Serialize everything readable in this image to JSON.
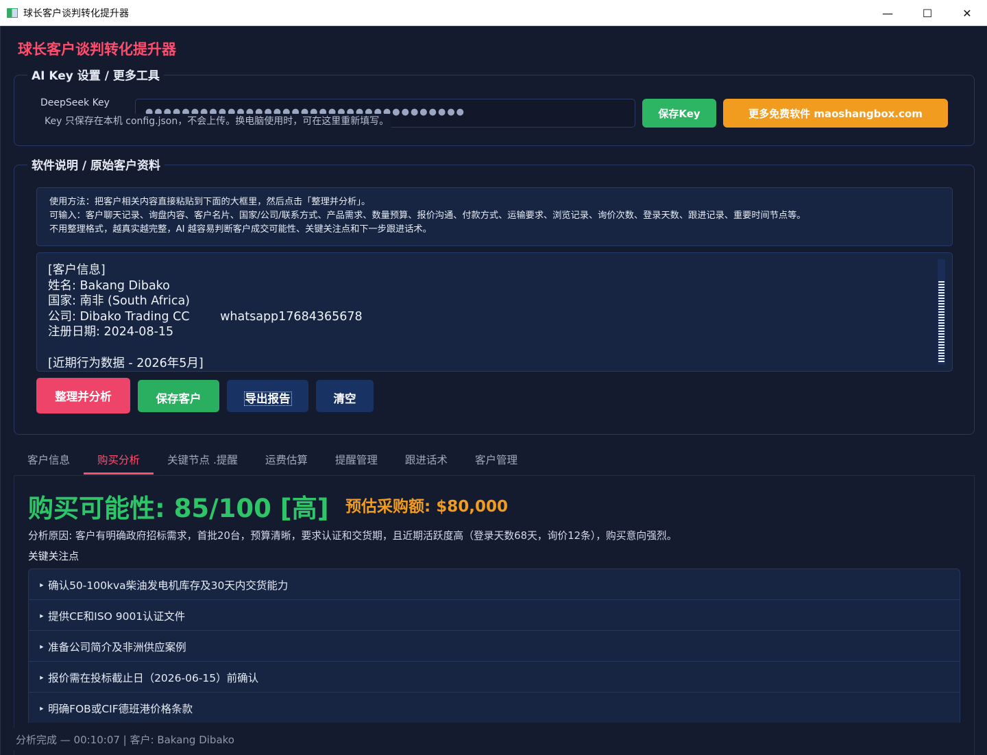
{
  "window": {
    "title": "球长客户谈判转化提升器",
    "minimize": "—",
    "maximize": "☐",
    "close": "✕"
  },
  "app_title": "球长客户谈判转化提升器",
  "key_section": {
    "legend": "AI Key 设置 / 更多工具",
    "label": "DeepSeek Key",
    "masked_value": "●●●●●●●●●●●●●●●●●●●●●●●●●●●●●●●●●●●",
    "hint": "Key 只保存在本机 config.json，不会上传。换电脑使用时，可在这里重新填写。",
    "save_button": "保存Key",
    "more_button": "更多免费软件  maoshangbox.com"
  },
  "info_section": {
    "legend": "软件说明 / 原始客户资料",
    "usage_lines": [
      "使用方法：把客户相关内容直接粘贴到下面的大框里，然后点击「整理并分析」。",
      "可输入：客户聊天记录、询盘内容、客户名片、国家/公司/联系方式、产品需求、数量预算、报价沟通、付款方式、运输要求、浏览记录、询价次数、登录天数、跟进记录、重要时间节点等。",
      "不用整理格式，越真实越完整，AI 越容易判断客户成交可能性、关键关注点和下一步跟进话术。"
    ],
    "customer_text": "[客户信息]\n姓名: Bakang Dibako\n国家: 南非 (South Africa)\n公司: Dibako Trading CC        whatsapp17684365678\n注册日期: 2024-08-15\n\n[近期行为数据 - 2026年5月]"
  },
  "actions": {
    "analyze": "整理并分析",
    "save_customer": "保存客户",
    "export": "导出报告",
    "clear": "清空"
  },
  "tabs": [
    {
      "label": "客户信息",
      "active": false
    },
    {
      "label": "购买分析",
      "active": true
    },
    {
      "label": "关键节点 .提醒",
      "active": false
    },
    {
      "label": "运费估算",
      "active": false
    },
    {
      "label": "提醒管理",
      "active": false
    },
    {
      "label": "跟进话术",
      "active": false
    },
    {
      "label": "客户管理",
      "active": false
    }
  ],
  "analysis": {
    "probability": "购买可能性: 85/100 [高]",
    "budget": "预估采购额: $80,000",
    "reason": "分析原因: 客户有明确政府招标需求，首批20台，预算清晰，要求认证和交货期，且近期活跃度高（登录天数68天，询价12条），购买意向强烈。",
    "key_points_title": "关键关注点",
    "key_points": [
      "‣ 确认50-100kva柴油发电机库存及30天内交货能力",
      "‣ 提供CE和ISO 9001认证文件",
      "‣ 准备公司简介及非洲供应案例",
      "‣ 报价需在投标截止日（2026-06-15）前确认",
      "‣ 明确FOB或CIF德班港价格条款"
    ]
  },
  "status": "分析完成 — 00:10:07 | 客户: Bakang Dibako",
  "colors": {
    "background": "#151b2e",
    "accent_pink": "#ff4d6d",
    "green": "#2db564",
    "orange": "#f29c1f",
    "navy_button": "#183263"
  }
}
